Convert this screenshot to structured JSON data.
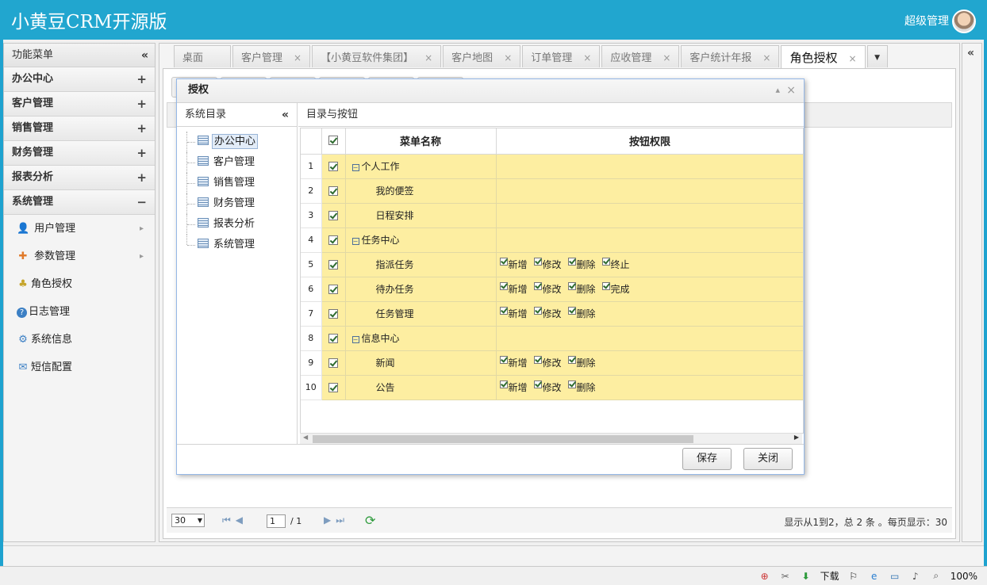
{
  "header": {
    "app_title": "小黄豆CRM开源版",
    "user_name": "超级管理"
  },
  "sidebar": {
    "title": "功能菜单",
    "collapse_icon": "«",
    "groups": [
      {
        "label": "办公中心",
        "sign": "+"
      },
      {
        "label": "客户管理",
        "sign": "+"
      },
      {
        "label": "销售管理",
        "sign": "+"
      },
      {
        "label": "财务管理",
        "sign": "+"
      },
      {
        "label": "报表分析",
        "sign": "+"
      },
      {
        "label": "系统管理",
        "sign": "−"
      }
    ],
    "items": [
      {
        "label": "用户管理",
        "icon": "user-icon",
        "glyph": "👤",
        "arrow": "▸"
      },
      {
        "label": "参数管理",
        "icon": "puzzle-icon",
        "glyph": "✚",
        "arrow": "▸"
      },
      {
        "label": "角色授权",
        "icon": "role-icon",
        "glyph": "♣"
      },
      {
        "label": "日志管理",
        "icon": "help-icon",
        "glyph": "?"
      },
      {
        "label": "系统信息",
        "icon": "gear-icon",
        "glyph": "⚙"
      },
      {
        "label": "短信配置",
        "icon": "mail-icon",
        "glyph": "✉"
      }
    ]
  },
  "tabs": [
    {
      "label": "桌面"
    },
    {
      "label": "客户管理",
      "close": "×"
    },
    {
      "label": "【小黄豆软件集团】",
      "close": "×"
    },
    {
      "label": "客户地图",
      "close": "×"
    },
    {
      "label": "订单管理",
      "close": "×"
    },
    {
      "label": "应收管理",
      "close": "×"
    },
    {
      "label": "客户统计年报",
      "close": "×"
    },
    {
      "label": "角色授权",
      "close": "×"
    }
  ],
  "tabs_more": "▼",
  "pager": {
    "page_size": "30",
    "page_input": "1",
    "page_total": "/ 1",
    "info": "显示从1到2，总 2 条 。每页显示：30"
  },
  "modal": {
    "title": "授权",
    "minimize": "▴",
    "close": "×",
    "left_title": "系统目录",
    "right_title": "目录与按钮",
    "tree": [
      "办公中心",
      "客户管理",
      "销售管理",
      "财务管理",
      "报表分析",
      "系统管理"
    ],
    "columns": {
      "menu": "菜单名称",
      "buttons": "按钮权限"
    },
    "rows": [
      {
        "n": "1",
        "name": "个人工作",
        "parent": true,
        "buttons": []
      },
      {
        "n": "2",
        "name": "我的便签",
        "parent": false,
        "buttons": []
      },
      {
        "n": "3",
        "name": "日程安排",
        "parent": false,
        "buttons": []
      },
      {
        "n": "4",
        "name": "任务中心",
        "parent": true,
        "buttons": []
      },
      {
        "n": "5",
        "name": "指派任务",
        "parent": false,
        "buttons": [
          "新增",
          "修改",
          "删除",
          "终止"
        ]
      },
      {
        "n": "6",
        "name": "待办任务",
        "parent": false,
        "buttons": [
          "新增",
          "修改",
          "删除",
          "完成"
        ]
      },
      {
        "n": "7",
        "name": "任务管理",
        "parent": false,
        "buttons": [
          "新增",
          "修改",
          "删除"
        ]
      },
      {
        "n": "8",
        "name": "信息中心",
        "parent": true,
        "buttons": []
      },
      {
        "n": "9",
        "name": "新闻",
        "parent": false,
        "buttons": [
          "新增",
          "修改",
          "删除"
        ]
      },
      {
        "n": "10",
        "name": "公告",
        "parent": false,
        "buttons": [
          "新增",
          "修改",
          "删除"
        ]
      }
    ],
    "save_label": "保存",
    "close_label": "关闭"
  },
  "ie_bar": {
    "download": "下载",
    "zoom": "100%"
  }
}
